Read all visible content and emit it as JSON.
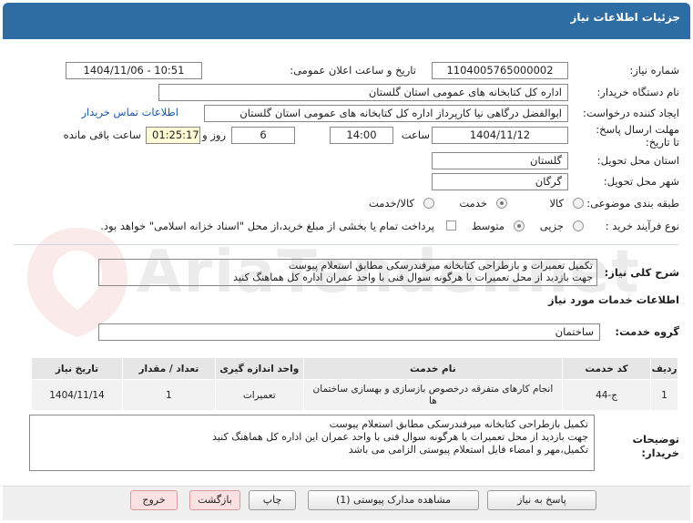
{
  "header": {
    "title": "جزئیات اطلاعات نیاز"
  },
  "labels": {
    "need_number": "شماره نیاز:",
    "announce_datetime": "تاریخ و ساعت اعلان عمومی:",
    "buyer_org": "نام دستگاه خریدار:",
    "creator": "ایجاد کننده درخواست:",
    "deadline": "مهلت ارسال پاسخ: تا تاریخ:",
    "time_word": "ساعت",
    "day_word": "روز و",
    "remaining": "ساعت باقی مانده",
    "province": "استان محل تحویل:",
    "city": "شهر محل تحویل:",
    "category": "طبقه بندی موضوعی:",
    "purchase_type": "نوع فرآیند خرید :",
    "summary": "شرح کلی نیاز:",
    "services_info": "اطلاعات خدمات مورد نیاز",
    "service_group": "گروه خدمت:",
    "buyer_notes": "توضیحات خریدار:"
  },
  "fields": {
    "need_number": "1104005765000002",
    "announce_datetime": "1404/11/06 - 10:51",
    "buyer_org": "اداره کل کتابخانه های عمومی استان گلستان",
    "creator": "ابوالفضل  درگاهی نیا کارپرداز اداره کل کتابخانه های عمومی استان گلستان",
    "contact_link": "اطلاعات تماس خریدار",
    "deadline_date": "1404/11/12",
    "deadline_time": "14:00",
    "days_remaining": "6",
    "time_remaining": "01:25:17",
    "province": "گلستان",
    "city": "گرگان",
    "service_group": "ساختمان"
  },
  "category_options": [
    {
      "label": "کالا",
      "selected": false
    },
    {
      "label": "خدمت",
      "selected": true
    },
    {
      "label": "کالا/خدمت",
      "selected": false
    }
  ],
  "purchase_options": [
    {
      "label": "جزیی",
      "selected": false
    },
    {
      "label": "متوسط",
      "selected": true
    }
  ],
  "treasury_note": "پرداخت تمام یا بخشی از مبلغ خرید،از محل \"اسناد خزانه اسلامی\" خواهد بود.",
  "summary_lines": [
    "تکمیل تعمیرات و بازطراحی کتابخانه میرفندرسکی مطابق استعلام پیوست",
    "جهت بازدید از محل تعمیرات یا هرگونه سوال فنی با واحد عمران اداره کل هماهنگ کنید"
  ],
  "table": {
    "headers": [
      "ردیف",
      "کد خدمت",
      "نام خدمت",
      "واحد اندازه گیری",
      "تعداد / مقدار",
      "تاریخ نیاز"
    ],
    "rows": [
      [
        "1",
        "ج-44",
        "انجام کارهای متفرقه درخصوص بازسازی و بهسازی ساختمان ها",
        "تعمیرات",
        "1",
        "1404/11/14"
      ]
    ]
  },
  "notes_lines": [
    "تکمیل بازطراحی کتابخانه میرفندرسکی مطابق استعلام پیوست",
    "جهت بازدید از محل تعمیرات یا هرگونه سوال فنی با واحد عمران این اداره کل هماهنگ کنید",
    "تکمیل،مهر و امضاء فایل استعلام پیوستی الزامی می باشد"
  ],
  "buttons": {
    "reply": "پاسخ به نیاز",
    "view_docs": "مشاهده مدارک پیوستی (1)",
    "print": "چاپ",
    "back": "بازگشت",
    "exit": "خروج"
  },
  "watermark": "AriaTender.net",
  "colors": {
    "header": "#2e6da4",
    "link": "#1a56b0",
    "highlight": "#fffbd4"
  }
}
